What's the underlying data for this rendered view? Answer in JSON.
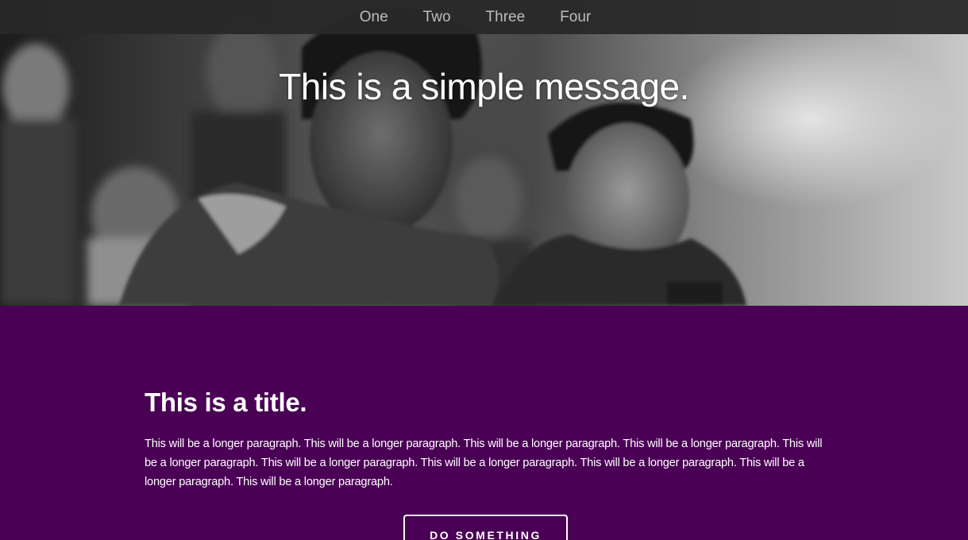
{
  "nav": {
    "items": [
      {
        "label": "One"
      },
      {
        "label": "Two"
      },
      {
        "label": "Three"
      },
      {
        "label": "Four"
      }
    ]
  },
  "hero": {
    "message": "This is a simple message."
  },
  "content": {
    "title": "This is a title.",
    "paragraph": "This will be a longer paragraph. This will be a longer paragraph. This will be a longer paragraph. This will be a longer paragraph. This will be a longer paragraph. This will be a longer paragraph. This will be a longer paragraph. This will be a longer paragraph. This will be a longer paragraph. This will be a longer paragraph.",
    "button_label": "DO SOMETHING"
  },
  "colors": {
    "content_background": "#4a0055",
    "navbar_background": "#282828",
    "nav_text": "#bdbdbd",
    "text": "#ffffff"
  }
}
